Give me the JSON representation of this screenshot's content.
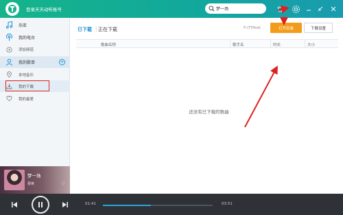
{
  "titlebar": {
    "login_text": "登录天天动听账号",
    "search_value": "梦一场"
  },
  "sidebar": {
    "items": [
      {
        "label": "乐库",
        "icon": "music-note-icon"
      },
      {
        "label": "我的电台",
        "icon": "radio-icon"
      },
      {
        "label": "添加频道",
        "icon": "add-channel-icon"
      },
      {
        "label": "我的歌单",
        "icon": "person-icon"
      },
      {
        "label": "本地音乐",
        "icon": "location-pin-icon"
      },
      {
        "label": "我的下载",
        "icon": "download-icon"
      },
      {
        "label": "我的最爱",
        "icon": "heart-icon"
      }
    ]
  },
  "now_playing": {
    "title": "梦一场",
    "artist": "那英"
  },
  "main": {
    "tab_downloaded": "已下载",
    "tab_downloading": "正在下载",
    "path": "F:\\TTPod\\",
    "open_dir_label": "打开目录",
    "settings_label": "下载设置",
    "columns": [
      "歌曲名称",
      "歌手名",
      "时长",
      "大小"
    ],
    "empty_message": "还没有已下载的歌曲"
  },
  "player": {
    "current_time": "01:41",
    "total_time": "03:51",
    "progress_fraction": 0.44
  },
  "colors": {
    "accent_green": "#15b48a",
    "accent_blue": "#1a8fd6",
    "button_orange": "#f39c1a",
    "annotation_red": "#e02020",
    "player_bg": "#2e3237"
  }
}
